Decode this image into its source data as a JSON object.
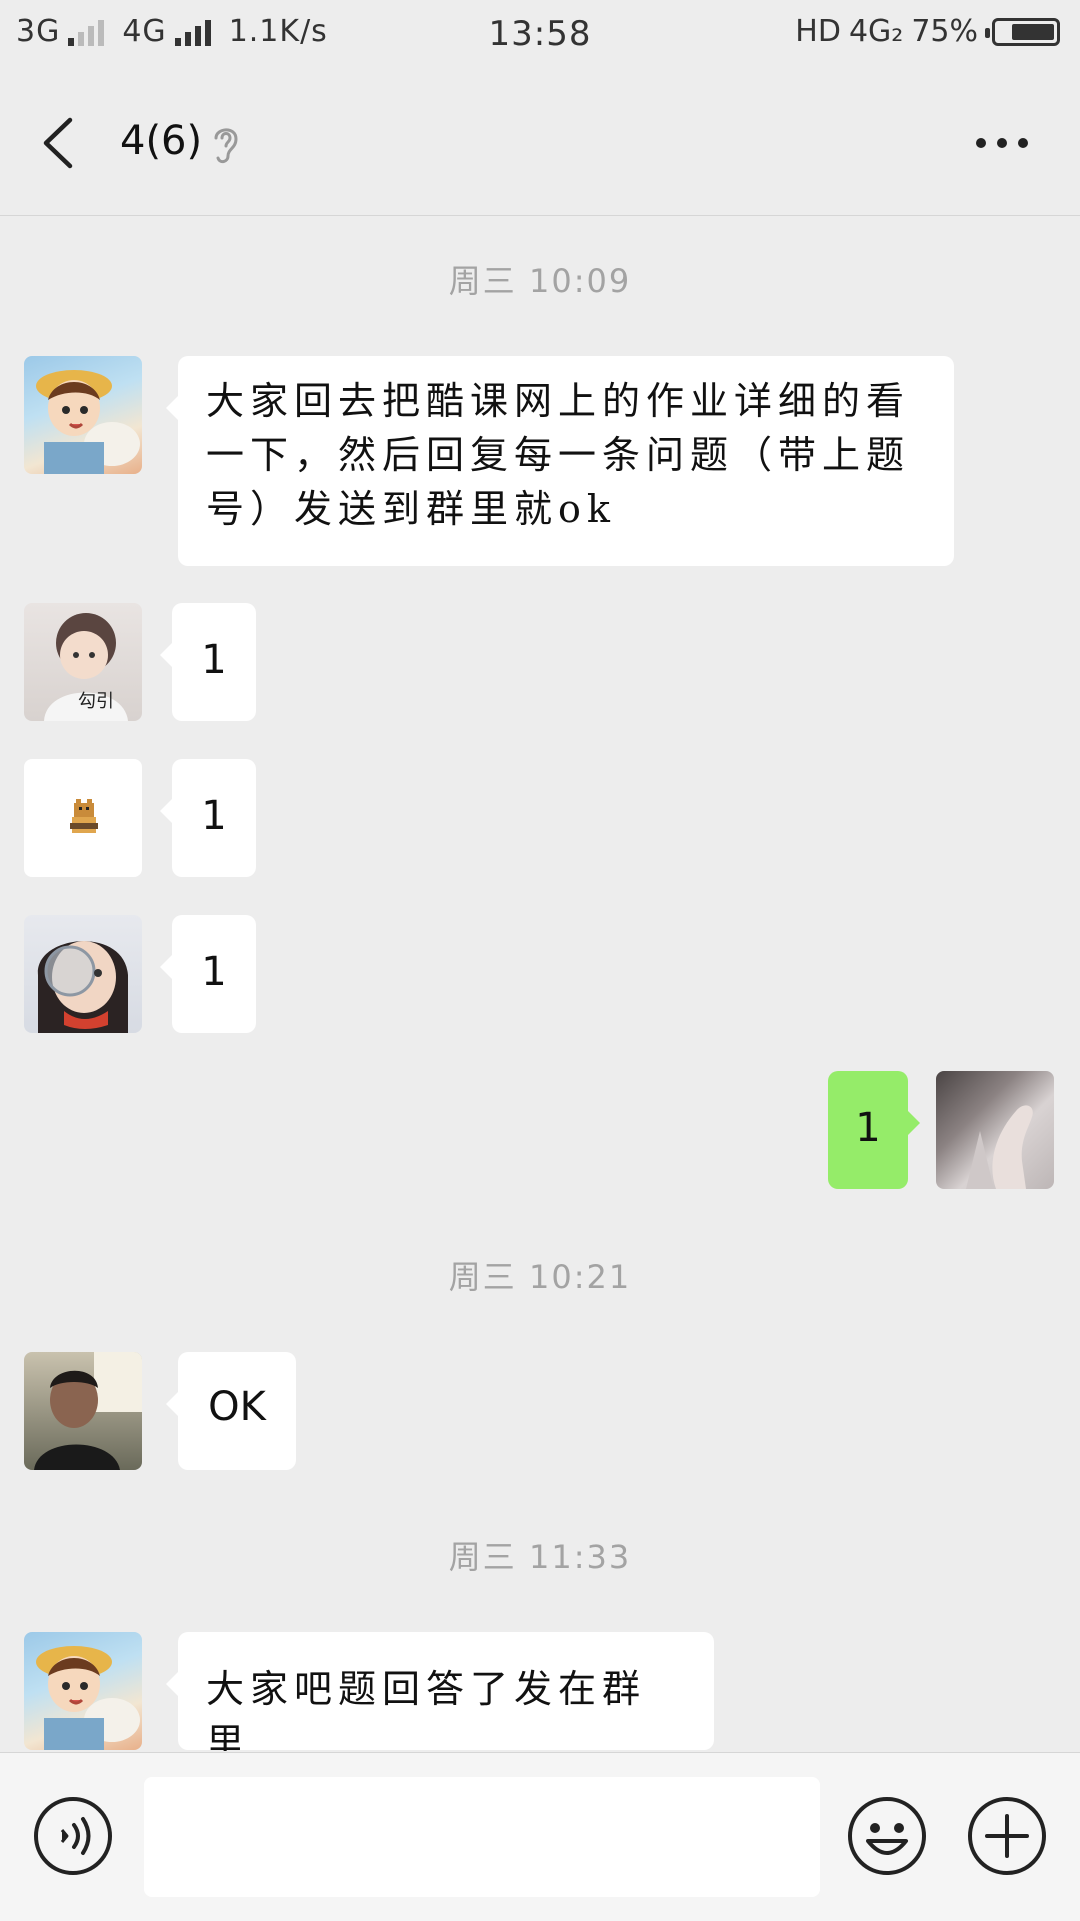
{
  "status_bar": {
    "network_1": "3G",
    "network_2": "4G",
    "speed": "1.1K/s",
    "time": "13:58",
    "hd": "HD",
    "network_3": "4G₂",
    "battery_text": "75%",
    "battery_level": 0.75
  },
  "header": {
    "title": "4(6)",
    "back_icon": "chevron-left-icon",
    "ear_icon": "earpiece-mode-icon",
    "more_icon": "more-dots-icon"
  },
  "messages": {
    "ts1": "周三 10:09",
    "m1": {
      "line1": "大家回去把酷课网上的作业详细的看",
      "line2": "一下，然后回复每一条问题（带上题",
      "line3": "号）发送到群里就ok"
    },
    "m2": "1",
    "m2_avatar_caption": "勾引",
    "m3": "1",
    "m4": "1",
    "m5": "1",
    "ts2": "周三 10:21",
    "m6": "OK",
    "ts3": "周三 11:33",
    "m7": "大家吧题回答了发在群里"
  },
  "input_bar": {
    "voice_icon": "voice-icon",
    "emoji_icon": "emoji-icon",
    "add_icon": "plus-icon"
  },
  "colors": {
    "background": "#ededed",
    "bubble_in": "#ffffff",
    "bubble_out": "#95ec69",
    "timestamp": "#a3a3a3"
  }
}
